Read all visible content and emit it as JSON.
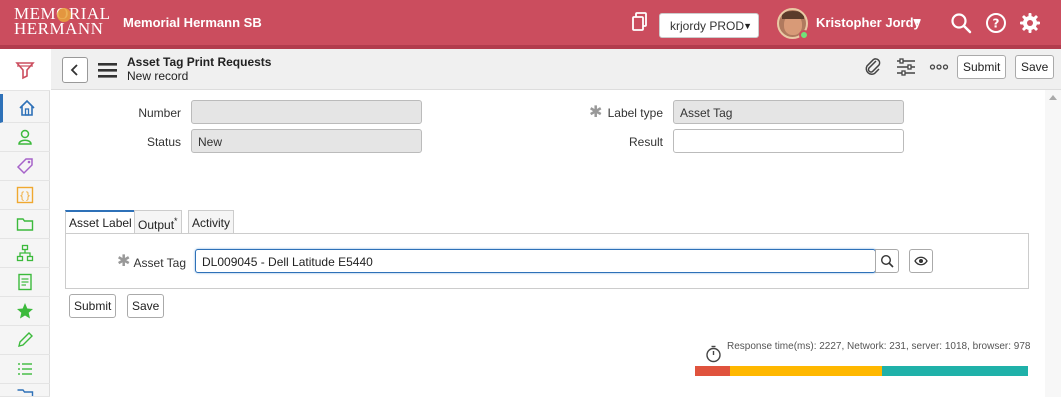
{
  "header": {
    "logo_line1": "MEMORIAL",
    "logo_line2": "HERMANN",
    "app_name": "Memorial Hermann SB",
    "instance": "krjordy PROD",
    "user_name": "Kristopher Jordy"
  },
  "form": {
    "title": "Asset Tag Print Requests",
    "subtitle": "New record",
    "submit_label": "Submit",
    "save_label": "Save"
  },
  "fields": {
    "number_label": "Number",
    "number_value": "",
    "status_label": "Status",
    "status_value": "New",
    "label_type_label": "Label type",
    "label_type_value": "Asset Tag",
    "result_label": "Result",
    "result_value": ""
  },
  "tabs": [
    {
      "label": "Asset Label"
    },
    {
      "label": "Output"
    },
    {
      "label": "Activity"
    }
  ],
  "output_marker": "*",
  "asset_tag": {
    "label": "Asset Tag",
    "value": "DL009045 - Dell Latitude E5440"
  },
  "footer": {
    "submit_label": "Submit",
    "save_label": "Save",
    "response_time": "Response time(ms): 2227, Network: 231, server: 1018, browser: 978"
  },
  "response_breakdown_ms": {
    "network": 231,
    "server": 1018,
    "browser": 978
  },
  "colors": {
    "banner": "#cb4d5e",
    "network_bar": "#e0533d",
    "server_bar": "#ffb800",
    "browser_bar": "#1fb1a9",
    "nav_green": "#3cba3c",
    "nav_blue": "#2e71b8"
  },
  "icons": [
    "filter-icon",
    "home-icon",
    "person-icon",
    "tag-icon",
    "braces-icon",
    "folder-icon",
    "hierarchy-icon",
    "document-icon",
    "star-icon",
    "pencil-icon",
    "list-icon",
    "folder-stack-icon",
    "paperclip-icon",
    "sliders-icon",
    "more-icon",
    "search-icon",
    "help-icon",
    "gear-icon",
    "copy-icon",
    "back-icon",
    "hamburger-icon",
    "magnifier-icon",
    "eye-icon",
    "timer-icon"
  ]
}
